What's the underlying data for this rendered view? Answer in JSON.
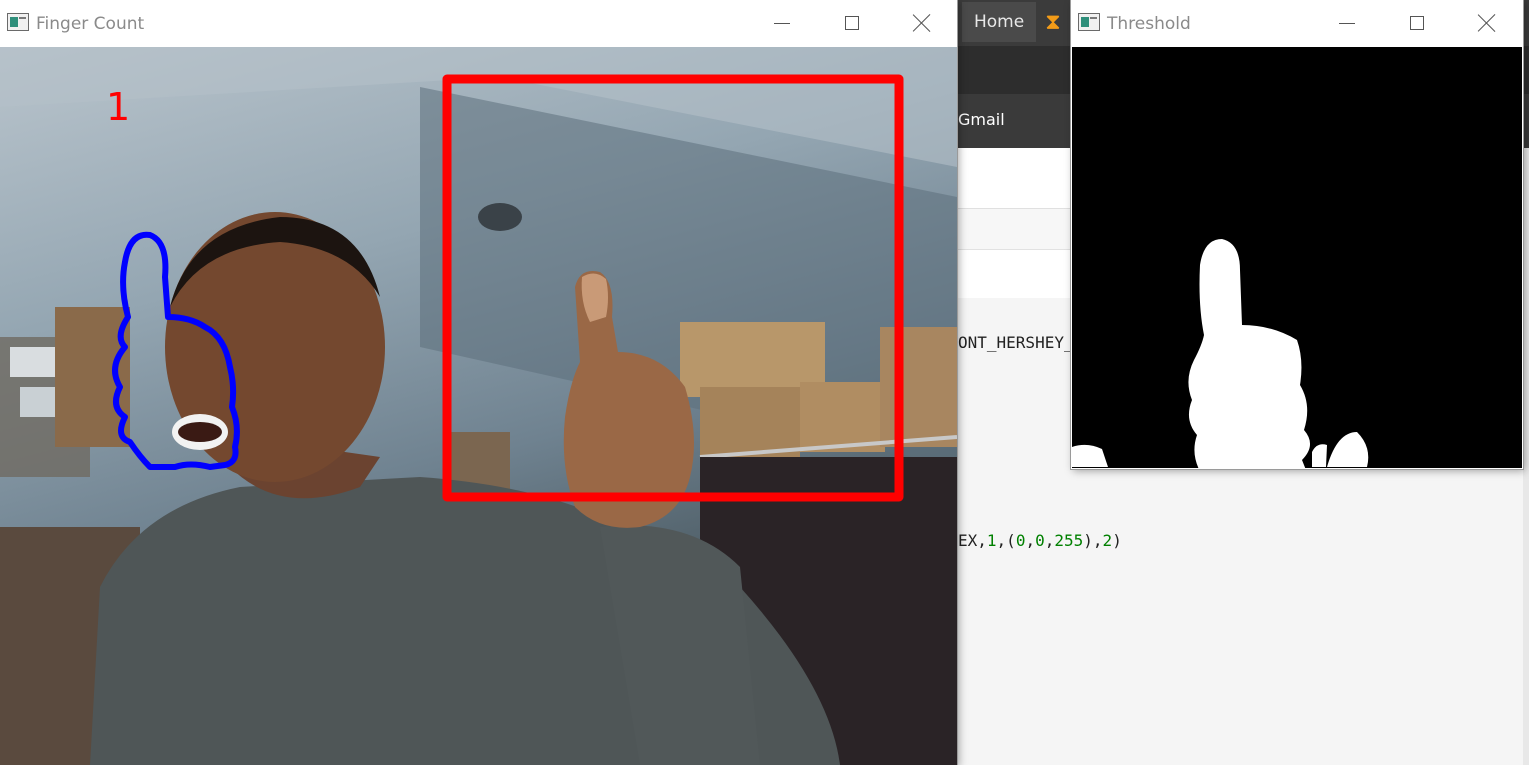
{
  "background_app": {
    "tab_home": "Home",
    "bookmark_gmail": "Gmail",
    "code_line_1": "ONT_HERSHEY_",
    "code_line_2_prefix": "EX,",
    "code_line_2_n1": "1",
    "code_line_2_mid1": ",(",
    "code_line_2_n2": "0",
    "code_line_2_c1": ",",
    "code_line_2_n3": "0",
    "code_line_2_c2": ",",
    "code_line_2_n4": "255",
    "code_line_2_mid2": "),",
    "code_line_2_n5": "2",
    "code_line_2_end": ")"
  },
  "finger_window": {
    "title": "Finger Count",
    "count": "1",
    "roi_color": "#ff0000",
    "contour_color": "#0000ff"
  },
  "threshold_window": {
    "title": "Threshold"
  },
  "icons": {
    "window_icon": "opencv-window-icon",
    "minimize": "minimize-icon",
    "maximize": "maximize-icon",
    "close": "close-icon",
    "hourglass": "hourglass-icon"
  }
}
